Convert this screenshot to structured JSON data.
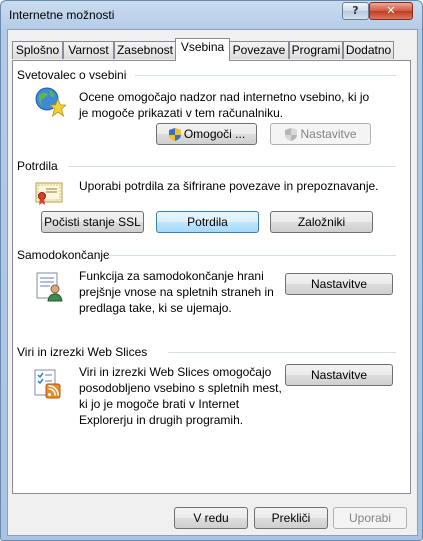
{
  "window": {
    "title": "Internetne možnosti",
    "help_label": "?",
    "close_label": "✕"
  },
  "tabs": [
    {
      "label": "Splošno",
      "active": false
    },
    {
      "label": "Varnost",
      "active": false
    },
    {
      "label": "Zasebnost",
      "active": false
    },
    {
      "label": "Vsebina",
      "active": true
    },
    {
      "label": "Povezave",
      "active": false
    },
    {
      "label": "Programi",
      "active": false
    },
    {
      "label": "Dodatno",
      "active": false
    }
  ],
  "content_advisor": {
    "title": "Svetovalec o vsebini",
    "description": "Ocene omogočajo nadzor nad internetno vsebino, ki jo je mogoče prikazati v tem računalniku.",
    "enable_label": "Omogoči ...",
    "settings_label": "Nastavitve"
  },
  "certificates": {
    "title": "Potrdila",
    "description": "Uporabi potrdila za šifrirane povezave in prepoznavanje.",
    "clear_ssl_label": "Počisti stanje SSL",
    "certificates_label": "Potrdila",
    "publishers_label": "Založniki"
  },
  "autocomplete": {
    "title": "Samodokončanje",
    "description": "Funkcija za samodokončanje hrani prejšnje vnose na spletnih straneh in predlaga take, ki se ujemajo.",
    "settings_label": "Nastavitve"
  },
  "feeds": {
    "title": "Viri in izrezki Web Slices",
    "description": "Viri in izrezki Web Slices omogočajo posodobljeno vsebino s spletnih mest, ki jo je mogoče brati v Internet Explorerju in drugih programih.",
    "settings_label": "Nastavitve"
  },
  "footer": {
    "ok_label": "V redu",
    "cancel_label": "Prekliči",
    "apply_label": "Uporabi"
  }
}
